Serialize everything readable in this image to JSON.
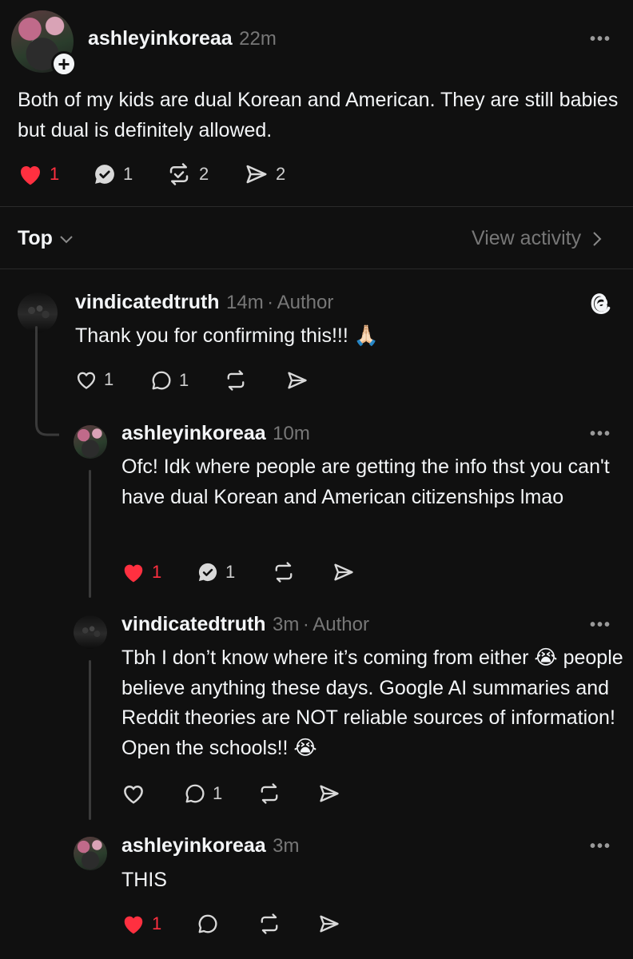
{
  "post": {
    "username": "ashleyinkoreaa",
    "time": "22m",
    "text": "Both of my kids are dual Korean and American. They are still babies but dual is definitely allowed.",
    "likes": "1",
    "replies": "1",
    "reposts": "2",
    "shares": "2"
  },
  "sort": {
    "label": "Top",
    "view_activity": "View activity"
  },
  "replies": [
    {
      "username": "vindicatedtruth",
      "time": "14m",
      "separator": "·",
      "role": "Author",
      "text": "Thank you for confirming this!!! 🙏🏻",
      "likes": "1",
      "replies": "1"
    },
    {
      "username": "ashleyinkoreaa",
      "time": "10m",
      "text": "Ofc! Idk where people are getting the info thst you can't have dual Korean and American citizenships lmao",
      "likes": "1",
      "replies": "1"
    },
    {
      "username": "vindicatedtruth",
      "time": "3m",
      "separator": "·",
      "role": "Author",
      "text": "Tbh I don’t know where it’s coming from either 😭 people believe anything these days. Google AI summaries and Reddit theories are NOT reliable sources of information! Open the schools!! 😭",
      "replies": "1"
    },
    {
      "username": "ashleyinkoreaa",
      "time": "3m",
      "text": "THIS",
      "likes": "1"
    }
  ],
  "icons": {
    "heart_filled": "heart-filled-icon",
    "heart_outline": "heart-outline-icon",
    "reply": "reply-icon",
    "repost": "repost-icon",
    "share": "share-icon",
    "threads_logo": "threads-logo-icon",
    "more": "more-icon"
  },
  "colors": {
    "background": "#101010",
    "text": "#f3f5f7",
    "muted": "#777777",
    "like_red": "#ff3040"
  }
}
